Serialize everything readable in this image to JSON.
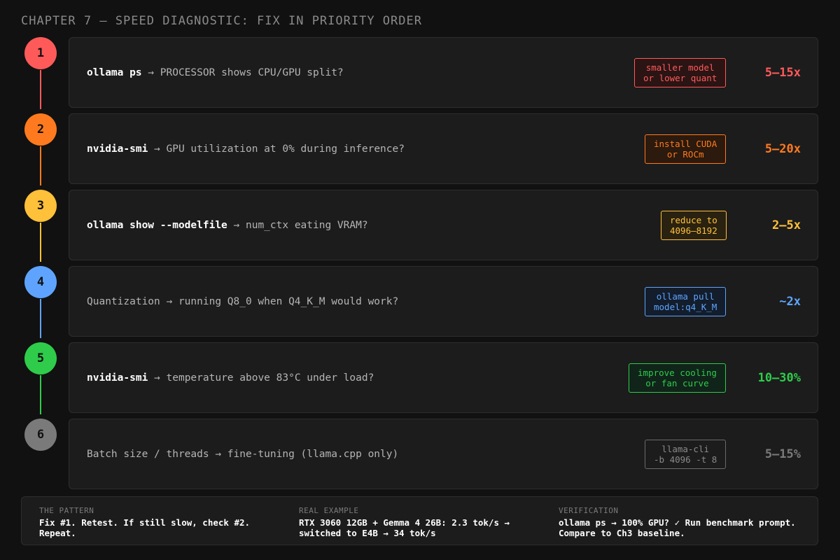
{
  "title": "CHAPTER 7 — SPEED DIAGNOSTIC: FIX IN PRIORITY ORDER",
  "steps": [
    {
      "num": "1",
      "cmd": "ollama ps",
      "desc": " → PROCESSOR shows CPU/GPU split?",
      "fix_line1": "smaller model",
      "fix_line2": "or lower quant",
      "gain": "5–15x",
      "color": "#ff5a5a",
      "fix_bg": "#2a1414"
    },
    {
      "num": "2",
      "cmd": "nvidia-smi",
      "desc": " → GPU utilization at 0% during inference?",
      "fix_line1": "install CUDA",
      "fix_line2": "or ROCm",
      "gain": "5–20x",
      "color": "#ff7a1f",
      "fix_bg": "#2b1a0d"
    },
    {
      "num": "3",
      "cmd": "ollama show --modelfile",
      "desc": " → num_ctx eating VRAM?",
      "fix_line1": "reduce to",
      "fix_line2": "4096–8192",
      "gain": "2–5x",
      "color": "#ffc03a",
      "fix_bg": "#2a2210"
    },
    {
      "num": "4",
      "cmd": "",
      "desc": "Quantization → running Q8_0 when Q4_K_M would work?",
      "fix_line1": "ollama pull",
      "fix_line2": "model:q4_K_M",
      "gain": "~2x",
      "color": "#5ea4ff",
      "fix_bg": "#131d2b"
    },
    {
      "num": "5",
      "cmd": "nvidia-smi",
      "desc": " → temperature above 83°C under load?",
      "fix_line1": "improve cooling",
      "fix_line2": "or fan curve",
      "gain": "10–30%",
      "color": "#2ecc4a",
      "fix_bg": "#10241a"
    },
    {
      "num": "6",
      "cmd": "",
      "desc": "Batch size / threads → fine-tuning (llama.cpp only)",
      "fix_line1": "llama-cli",
      "fix_line2": "-b 4096 -t 8",
      "gain": "5–15%",
      "color": "#7a7a7a",
      "fix_bg": "#1c1c1c"
    }
  ],
  "footer": {
    "pattern_label": "THE PATTERN",
    "pattern_line1": "Fix #1. Retest. If still slow, check #2.",
    "pattern_line2": "Repeat.",
    "example_label": "REAL EXAMPLE",
    "example_line1": "RTX 3060 12GB + Gemma 4 26B: 2.3 tok/s →",
    "example_line2": "switched to E4B → 34 tok/s",
    "verify_label": "VERIFICATION",
    "verify_line1": "ollama ps → 100% GPU? ✓ Run benchmark prompt.",
    "verify_line2": "Compare to Ch3 baseline."
  }
}
